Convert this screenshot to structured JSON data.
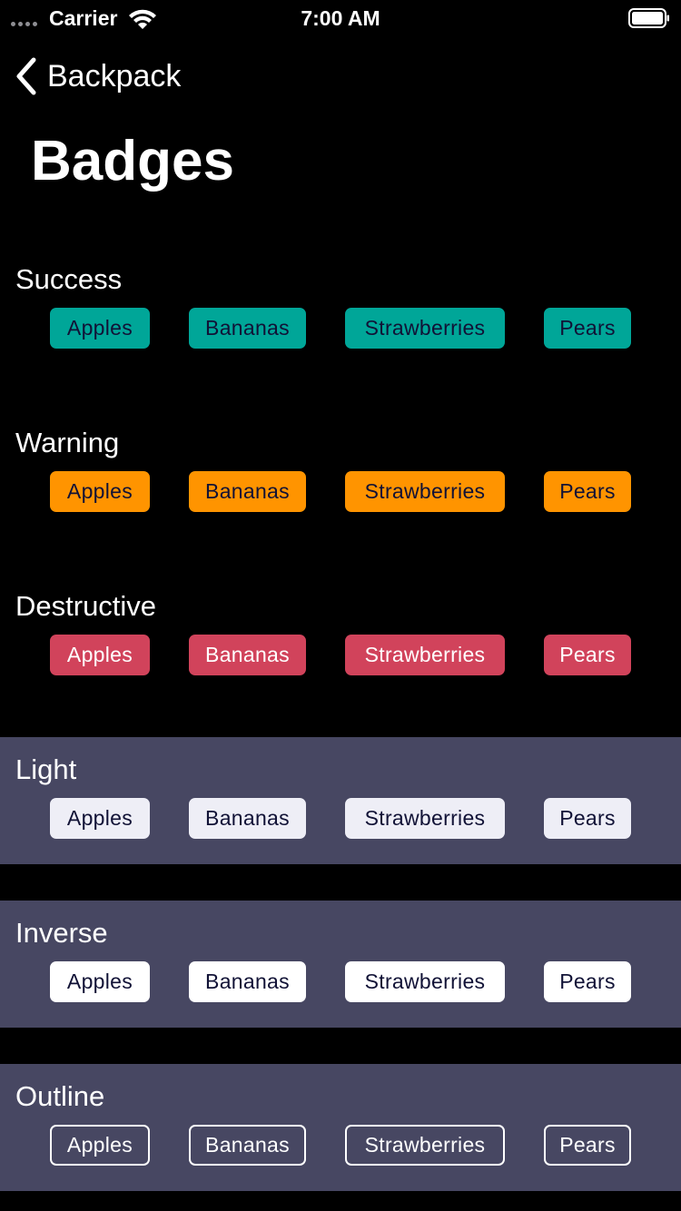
{
  "status_bar": {
    "carrier": "Carrier",
    "time": "7:00 AM",
    "icons": [
      "signal-dots-icon",
      "wifi-icon",
      "battery-icon"
    ]
  },
  "nav": {
    "back_label": "Backpack",
    "back_icon": "chevron-left-icon"
  },
  "page": {
    "title": "Badges"
  },
  "colors": {
    "background": "#000000",
    "tinted_section": "#474762",
    "success": "#00a698",
    "warning": "#ff9400",
    "destructive": "#d1435b",
    "light": "#eeeef6",
    "inverse": "#ffffff",
    "badge_dark_text": "#111236"
  },
  "sections": [
    {
      "label": "Success",
      "badges": [
        "Apples",
        "Bananas",
        "Strawberries",
        "Pears"
      ]
    },
    {
      "label": "Warning",
      "badges": [
        "Apples",
        "Bananas",
        "Strawberries",
        "Pears"
      ]
    },
    {
      "label": "Destructive",
      "badges": [
        "Apples",
        "Bananas",
        "Strawberries",
        "Pears"
      ]
    },
    {
      "label": "Light",
      "badges": [
        "Apples",
        "Bananas",
        "Strawberries",
        "Pears"
      ]
    },
    {
      "label": "Inverse",
      "badges": [
        "Apples",
        "Bananas",
        "Strawberries",
        "Pears"
      ]
    },
    {
      "label": "Outline",
      "badges": [
        "Apples",
        "Bananas",
        "Strawberries",
        "Pears"
      ]
    }
  ]
}
